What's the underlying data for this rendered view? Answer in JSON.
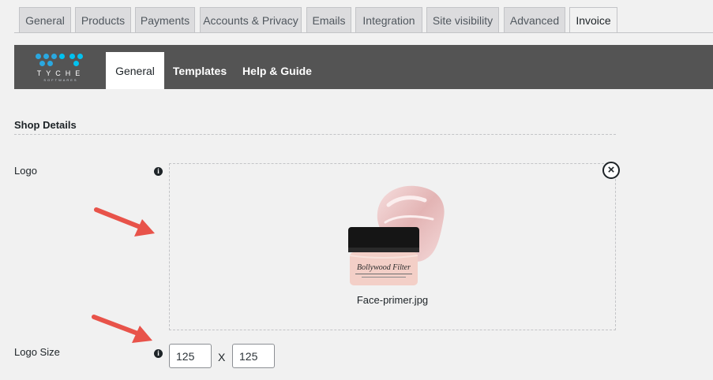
{
  "wp_tabs": [
    {
      "label": "General",
      "active": false
    },
    {
      "label": "Products",
      "active": false
    },
    {
      "label": "Payments",
      "active": false
    },
    {
      "label": "Accounts & Privacy",
      "active": false
    },
    {
      "label": "Emails",
      "active": false
    },
    {
      "label": "Integration",
      "active": false
    },
    {
      "label": "Site visibility",
      "active": false
    },
    {
      "label": "Advanced",
      "active": false
    },
    {
      "label": "Invoice",
      "active": true
    }
  ],
  "plugin_nav": {
    "brand": {
      "name": "TYCHE",
      "sub": "SOFTWARES",
      "dot_colors": [
        "#2aa8e0",
        "#00c2f0"
      ]
    },
    "items": [
      {
        "label": "General",
        "active": true
      },
      {
        "label": "Templates",
        "active": false
      },
      {
        "label": "Help & Guide",
        "active": false
      }
    ],
    "bar_color": "#545454"
  },
  "shop_details": {
    "title": "Shop Details",
    "logo": {
      "label": "Logo",
      "info_icon": "info-icon",
      "remove_icon": "close-circle-icon",
      "file_name": "Face-primer.jpg",
      "image_text": "Bollywood Filter"
    },
    "logo_size": {
      "label": "Logo Size",
      "info_icon": "info-icon",
      "width_value": "125",
      "height_value": "125",
      "separator": "X"
    }
  },
  "annotation_color": "#e8534a"
}
